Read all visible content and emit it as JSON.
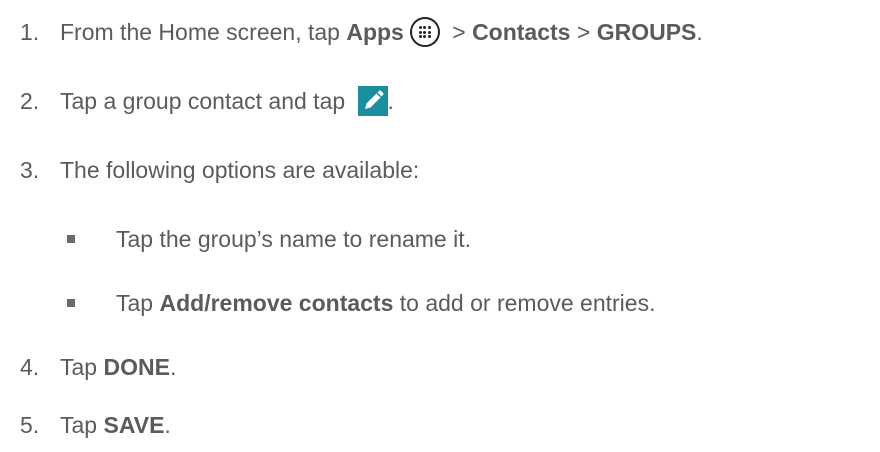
{
  "steps": [
    {
      "num": "1.",
      "parts": {
        "a": "From the Home screen, tap ",
        "b_apps": "Apps",
        "c": " > ",
        "d_contacts": "Contacts",
        "e": " > ",
        "f_groups": "GROUPS",
        "g": "."
      },
      "icon": "apps-grid-icon"
    },
    {
      "num": "2.",
      "parts": {
        "a": "Tap a group contact and tap ",
        "b": "."
      },
      "icon": "edit-pencil-icon"
    },
    {
      "num": "3.",
      "text": "The following options are available:"
    },
    {
      "num": "4.",
      "parts": {
        "a": "Tap ",
        "b_done": "DONE",
        "c": "."
      }
    },
    {
      "num": "5.",
      "parts": {
        "a": "Tap ",
        "b_save": "SAVE",
        "c": "."
      }
    }
  ],
  "sub_bullets": [
    {
      "text": "Tap the group’s name to rename it."
    },
    {
      "a": "Tap ",
      "b_bold": "Add/remove contacts",
      "c": " to add or remove entries."
    }
  ],
  "colors": {
    "text": "#5b5b5b",
    "edit_icon_bg": "#1a8fa0"
  }
}
